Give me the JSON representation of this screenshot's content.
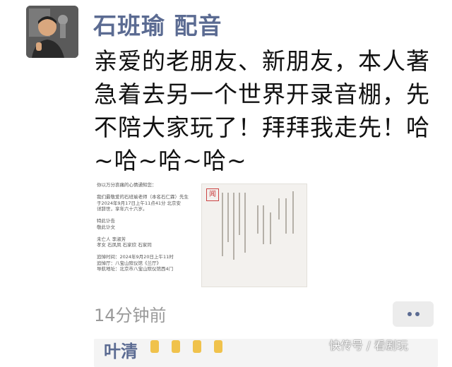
{
  "post": {
    "author": "石班瑜 配音",
    "text": "亲爱的老朋友、新朋友，本人著急着去另一个世界开录音棚，先不陪大家玩了！拜拜我走先！哈~哈~哈~哈~",
    "timestamp": "14分钟前"
  },
  "attachment": {
    "left_lines": [
      "你以万分哀痛的心情通知您：",
      "",
      "我们最敬爱的石班瑜老师（本名石仁霖）先生",
      "于2024年9月17日上午11点41分 北京安",
      "详辞世，享年六十六岁。",
      "",
      "特此讣告",
      "敬此讣文",
      "",
      "未亡人 李淑芳",
      "孝女 石凤凤 石家欣 石家同",
      "",
      "追悼时间：2024年9月20日上午11时",
      "追悼厅：八宝山殡仪馆《兰厅》",
      "导航地址：北京市八宝山殡仪馆西4门"
    ],
    "seal_char": "闻"
  },
  "comment": {
    "author": "叶清"
  },
  "watermark": "快传号 / 看剧玩",
  "icons": {
    "avatar": "avatar-photo",
    "more": "more-dots-icon"
  }
}
